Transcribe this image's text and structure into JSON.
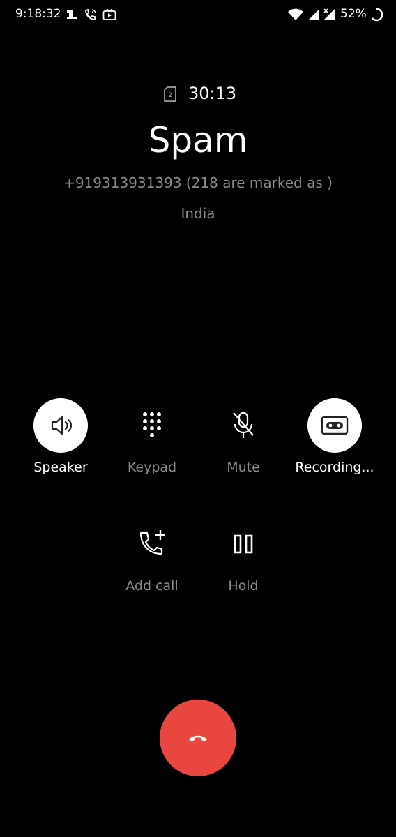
{
  "status_bar": {
    "time": "9:18:32",
    "battery": "52%",
    "icons": [
      "notification-1-icon",
      "wifi-call-icon",
      "tv-icon",
      "wifi-icon",
      "signal-icon",
      "signal-x-icon",
      "battery-charging-icon"
    ]
  },
  "call": {
    "duration": "30:13",
    "sim_slot": "2",
    "caller_name": "Spam",
    "number_line": "+919313931393 (218 are marked as )",
    "location": "India"
  },
  "controls": {
    "speaker": {
      "label": "Speaker",
      "active": true,
      "icon": "speaker-icon"
    },
    "keypad": {
      "label": "Keypad",
      "active": false,
      "icon": "keypad-icon"
    },
    "mute": {
      "label": "Mute",
      "active": false,
      "icon": "mic-off-icon"
    },
    "recording": {
      "label": "Recording...",
      "active": true,
      "icon": "cassette-icon"
    },
    "add_call": {
      "label": "Add call",
      "icon": "add-call-icon"
    },
    "hold": {
      "label": "Hold",
      "icon": "pause-icon"
    }
  },
  "colors": {
    "background": "#000000",
    "end_call": "#e8463f",
    "inactive_text": "#8a8a8a"
  },
  "end_call": {
    "icon": "phone-hangup-icon"
  }
}
